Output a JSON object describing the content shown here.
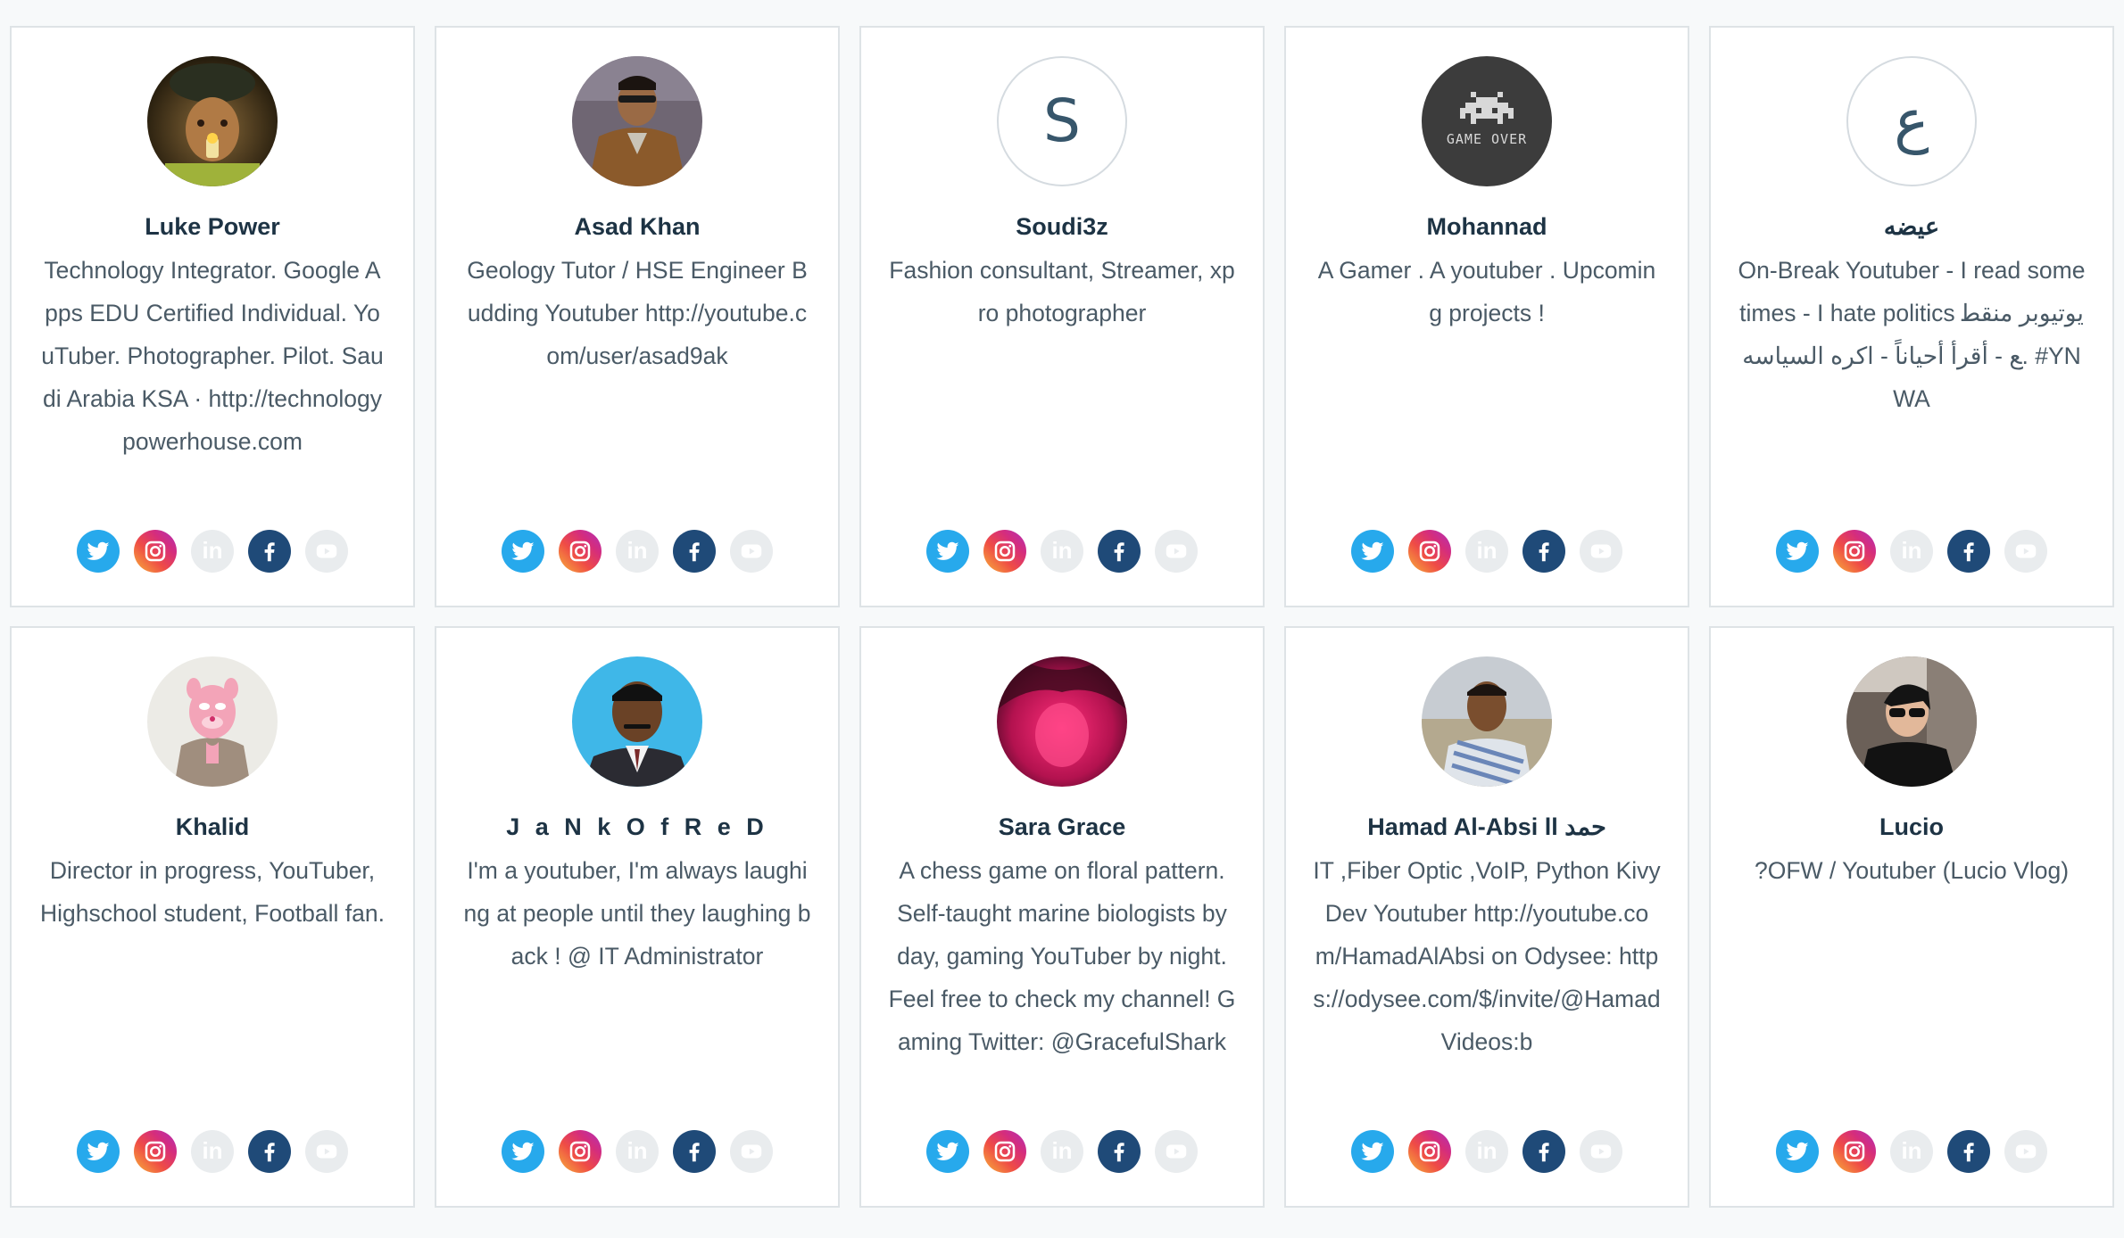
{
  "cards": [
    {
      "name": "Luke Power",
      "avatar": "photo-man-cap",
      "bio": "Technology Integrator. Google Apps EDU Certified Individual. YouTuber. Photographer. Pilot. Saudi Arabia KSA · http://technologypowerhouse.com"
    },
    {
      "name": "Asad Khan",
      "avatar": "photo-man-jacket",
      "bio": "Geology Tutor / HSE Engineer Budding Youtuber http://youtube.com/user/asad9ak"
    },
    {
      "name": "Soudi3z",
      "avatar_letter": "S",
      "bio": "Fashion consultant, Streamer, xpro photographer"
    },
    {
      "name": "Mohannad",
      "avatar": "game-over",
      "avatar_text": "GAME OVER",
      "bio": "A Gamer . A youtuber . Upcoming projects !"
    },
    {
      "name": "عيضه",
      "avatar_letter": "ع",
      "bio": "On-Break Youtuber - I read sometimes - I hate politics يوتيوبر منقطع - أقرأ أحياناً - اكره السياسه. #YNWA"
    },
    {
      "name": "Khalid",
      "avatar": "pink-panther",
      "bio": "Director in progress, YouTuber, Highschool student, Football fan."
    },
    {
      "name": "J a N k O f R e D",
      "avatar": "photo-man-blue",
      "bio": "I'm a youtuber, I'm always laughing at people until they laughing back ! @ IT Administrator"
    },
    {
      "name": "Sara Grace",
      "avatar": "photo-pink",
      "bio": "A chess game on floral pattern. Self-taught marine biologists by day, gaming YouTuber by night. Feel free to check my channel! Gaming Twitter: @GracefulShark"
    },
    {
      "name": "Hamad Al-Absi ll حمد",
      "avatar": "photo-man-outdoor",
      "bio": "IT ,Fiber Optic ,VoIP, Python Kivy Dev Youtuber http://youtube.com/HamadAlAbsi on Odysee: https://odysee.com/$/invite/@HamadVideos:b"
    },
    {
      "name": "Lucio",
      "avatar": "photo-man-car",
      "bio": "?OFW / Youtuber (Lucio Vlog)"
    }
  ],
  "social_icons": [
    "twitter-icon",
    "instagram-icon",
    "linkedin-icon",
    "facebook-icon",
    "youtube-icon"
  ],
  "linkedin_text": "in",
  "colors": {
    "twitter": "#27a9ec",
    "facebook": "#1f4a78",
    "disabled": "#e9ecee",
    "name": "#1d3344",
    "text": "#4a5a66",
    "border": "#dee3e6"
  }
}
